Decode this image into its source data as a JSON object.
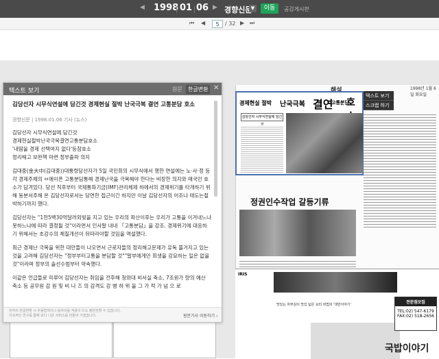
{
  "toolbar": {
    "date": {
      "year": "1998",
      "month": "01",
      "day": "06"
    },
    "newspaper": "경향신문",
    "go_label": "이동",
    "notice_label": "공감게시판"
  },
  "pager": {
    "current_page": "5",
    "total_pages": "/ 32"
  },
  "text_panel": {
    "title": "텍스트 보기",
    "original_label": "원문",
    "translated_label": "한글변환",
    "article_headline": "김당선자 시무식연설에 담긴것 경제현실 절박 난국극복 결연 고통분담 호소",
    "article_meta": "경향신문 | 1998.01.06 기사 (뉴스)",
    "paragraphs": [
      "김당선자 시무식연설에 담긴것\n경제현실절박난국극복결연고통분담호소\n'내땀을 경제 선택여지 없다'등참호소\n정리해고 보완책 마련 정부출파 의지",
      "김대중(金大中(김대중))대통령당선자가 5일 국민회의 시무식에서 행한 연설에는 노·사·정 등 각 경제주체의 ㅂ에이픈 고통분담통해 경제난국을 극복해야 한다는 비장한 의지와 매국민 호소가 담겨있다. 당선 직후부터 국제통화기금(IMF)관리체제 하에서의 경제위기를 타개하기 위해 동분서주해 온 김당선자로서는 당연한 접근이긴 하지만 이날 김당선자의 어조나 태도는절박하기까지 했다.",
      "김당선자는 \"1천5백30억달러외빚을 지고 있는 우리의 파산이후는 우리가 고통을 이겨내느냐 못하느냐에 따라 결정될 것\"이라면서 인사말 내내 「고통분담」을 강조. 경제위기에 대응하기 위해서는 초강수의 체질개선이 뒤따라야할 것임을 역설했다.",
      "최근 경제난 극복을 위한 대안들이 나오면서 근로자들의 정리해고문제가 유독 불거지고 있는 것을 고려해 김당선자는 \"정부부터고통을 분담할 것\"\"말부에게만 희생을 강요하는 일은 없을 것\"이라며 정부의 솔선수범부터 약속했다.",
      "이같은 언급들로 미루어 김당선자는 취임을 전후해 청와대 비서실 축소, 7조원가 량의 예산 축소 등 공무원 감 원 및 비 나 즈 의 감격도 강 병 하 위 을 그 가 적 가 넘 으 로"
    ],
    "footer_note": "한자의 한글변환 시 두음법칙이나 동자이음 적용이 다소 불완전할 수 있습니다.\n지속적인 연구를 통해 보다 나은 서비스를 만들어 가겠습니다.",
    "view_original_label": "원문기사 이동하기 ›"
  },
  "newspaper_page": {
    "section": "해설",
    "date": "1998년 1월 6일 화요일",
    "lead_headline_1": "경제현실 절박",
    "lead_headline_2": "난국극복",
    "lead_headline_3": "결연",
    "lead_headline_4": "고통분담",
    "lead_headline_5": "호소",
    "lead_sub": "김당선자 시무식연설에 담긴것",
    "second_headline": "정권인수작업 갈등기류",
    "context_menu": [
      "텍스트 보기",
      "스크랩 하기"
    ],
    "ad_logo": "IRIS",
    "ad_caption": "맛있는 자부심이 맛있 넓은 요리 비법의 '대반이야기'",
    "ad_phone_title": "전문점모집",
    "ad_phone_1": "TEL:02) 547-6179",
    "ad_phone_2": "FAX:02) 518-2656",
    "ad_brand": "국밥이야기"
  }
}
